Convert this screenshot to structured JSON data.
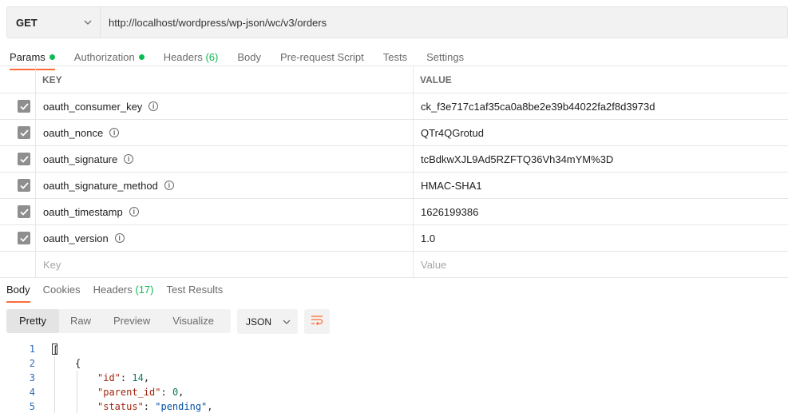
{
  "request": {
    "method": "GET",
    "url": "http://localhost/wordpress/wp-json/wc/v3/orders"
  },
  "request_tabs": [
    {
      "label": "Params",
      "dot": true,
      "active": true
    },
    {
      "label": "Authorization",
      "dot": true
    },
    {
      "label": "Headers",
      "count": "(6)"
    },
    {
      "label": "Body"
    },
    {
      "label": "Pre-request Script"
    },
    {
      "label": "Tests"
    },
    {
      "label": "Settings"
    }
  ],
  "params_table": {
    "header_key": "KEY",
    "header_value": "VALUE",
    "rows": [
      {
        "key": "oauth_consumer_key",
        "value": "ck_f3e717c1af35ca0a8be2e39b44022fa2f8d3973d"
      },
      {
        "key": "oauth_nonce",
        "value": "QTr4QGrotud"
      },
      {
        "key": "oauth_signature",
        "value": "tcBdkwXJL9Ad5RZFTQ36Vh34mYM%3D"
      },
      {
        "key": "oauth_signature_method",
        "value": "HMAC-SHA1"
      },
      {
        "key": "oauth_timestamp",
        "value": "1626199386"
      },
      {
        "key": "oauth_version",
        "value": "1.0"
      }
    ],
    "placeholder_key": "Key",
    "placeholder_value": "Value"
  },
  "response_tabs": [
    {
      "label": "Body",
      "active": true
    },
    {
      "label": "Cookies"
    },
    {
      "label": "Headers",
      "count": "(17)"
    },
    {
      "label": "Test Results"
    }
  ],
  "view_modes": [
    "Pretty",
    "Raw",
    "Preview",
    "Visualize"
  ],
  "format": "JSON",
  "code_lines": [
    {
      "num": "1",
      "text": "["
    },
    {
      "num": "2",
      "text": "{"
    },
    {
      "num": "3",
      "key": "\"id\"",
      "value": "14",
      "type": "n"
    },
    {
      "num": "4",
      "key": "\"parent_id\"",
      "value": "0",
      "type": "n"
    },
    {
      "num": "5",
      "key": "\"status\"",
      "value": "\"pending\"",
      "type": "s"
    }
  ],
  "colors": {
    "accent": "#ff6c37",
    "dot": "#0cbb52"
  },
  "icons": [
    "chevron-down-icon",
    "checkbox-checked-icon",
    "info-icon",
    "wrap-lines-icon"
  ]
}
